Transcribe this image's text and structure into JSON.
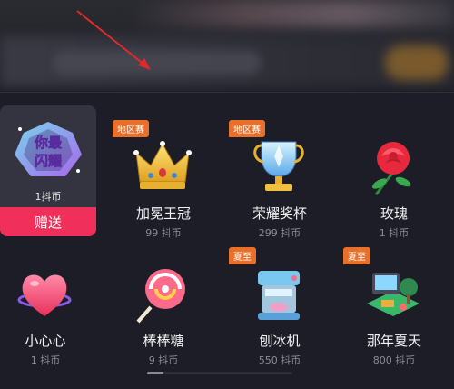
{
  "selected_gift": {
    "title_art": "你最闪耀",
    "price": "1抖币",
    "send_label": "赠送"
  },
  "gifts": [
    {
      "name": "加冕王冠",
      "price": "99 抖币",
      "badge": "地区赛",
      "icon": "crown-icon"
    },
    {
      "name": "荣耀奖杯",
      "price": "299 抖币",
      "badge": "地区赛",
      "icon": "trophy-icon"
    },
    {
      "name": "玫瑰",
      "price": "1 抖币",
      "badge": "",
      "icon": "rose-icon"
    },
    {
      "name": "小心心",
      "price": "1 抖币",
      "badge": "",
      "icon": "heart-icon"
    },
    {
      "name": "棒棒糖",
      "price": "9 抖币",
      "badge": "",
      "icon": "lollipop-icon"
    },
    {
      "name": "刨冰机",
      "price": "550 抖币",
      "badge": "夏至",
      "icon": "ice-machine-icon"
    },
    {
      "name": "那年夏天",
      "price": "800 抖币",
      "badge": "夏至",
      "icon": "summer-scene-icon"
    }
  ],
  "colors": {
    "background": "#1c1d26",
    "send_button": "#f0305a",
    "badge": "#e8702a",
    "annotation_arrow": "#e02a2a"
  }
}
